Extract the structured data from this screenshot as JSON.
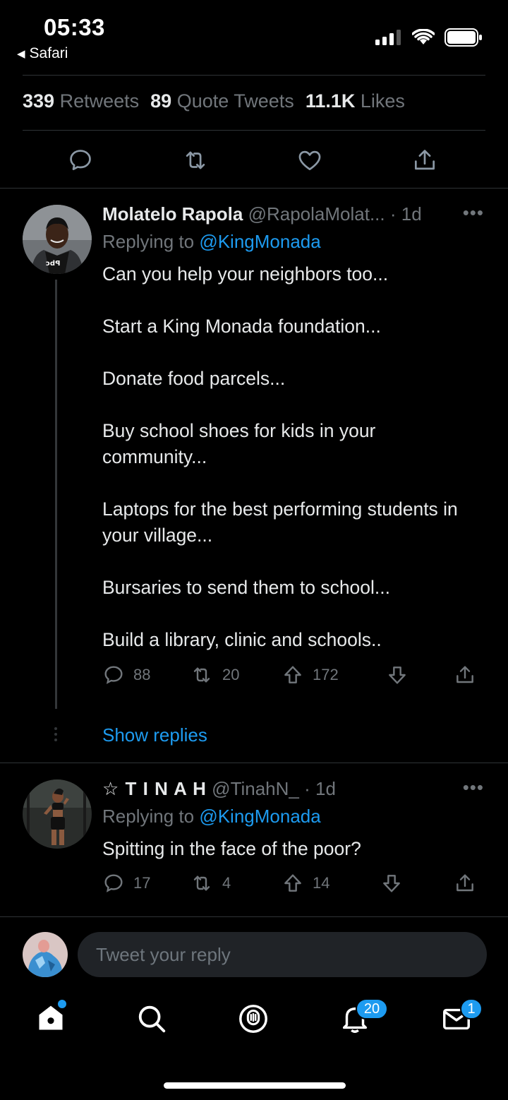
{
  "status_bar": {
    "time": "05:33",
    "back_app": "Safari"
  },
  "stats": {
    "retweets_count": "339",
    "retweets_label": "Retweets",
    "quotes_count": "89",
    "quotes_label": "Quote Tweets",
    "likes_count": "11.1K",
    "likes_label": "Likes"
  },
  "replies": [
    {
      "name": "Molatelo Rapola",
      "handle": "@RapolaMolat...",
      "time": "· 1d",
      "replying_prefix": "Replying to",
      "replying_to": "@KingMonada",
      "paragraphs": [
        "Can you help your neighbors too...",
        "Start a King Monada foundation...",
        "Donate food parcels...",
        "Buy school shoes for kids in your community...",
        "Laptops for the best performing students in your village...",
        "Bursaries to send them to school...",
        "Build a library, clinic and schools.."
      ],
      "reply_count": "88",
      "retweet_count": "20",
      "upvote_count": "172",
      "show_replies": "Show replies"
    },
    {
      "name": "☆ T I N A H",
      "handle": "@TinahN_",
      "time": "· 1d",
      "replying_prefix": "Replying to",
      "replying_to": "@KingMonada",
      "paragraphs": [
        "Spitting in the face of the poor?"
      ],
      "reply_count": "17",
      "retweet_count": "4",
      "upvote_count": "14"
    }
  ],
  "compose": {
    "placeholder": "Tweet your reply"
  },
  "tabbar": {
    "notifications_badge": "20",
    "messages_badge": "1"
  },
  "colors": {
    "background": "#000000",
    "accent": "#1d9bf0",
    "muted": "#71767b"
  }
}
